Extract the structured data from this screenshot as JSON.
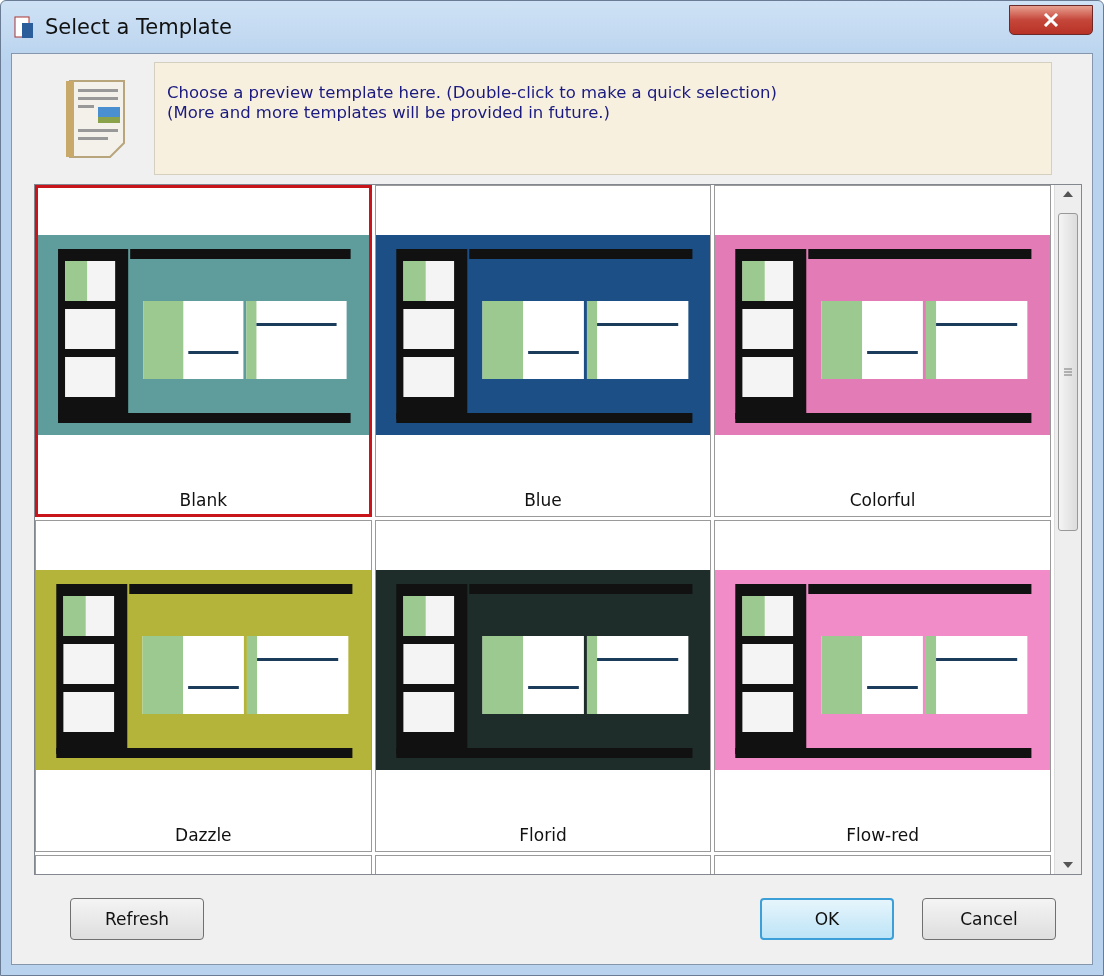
{
  "window": {
    "title": "Select a Template"
  },
  "banner": {
    "lines": [
      "Choose a preview template here. (Double-click to make a quick selection)",
      "(More and more templates will be provided in future.)"
    ]
  },
  "templates": [
    {
      "name": "Blank",
      "selected": true,
      "color": "#5f9c9c"
    },
    {
      "name": "Blue",
      "selected": false,
      "color": "#1b4f86"
    },
    {
      "name": "Colorful",
      "selected": false,
      "color": "#e27bb6"
    },
    {
      "name": "Dazzle",
      "selected": false,
      "color": "#b4b43a"
    },
    {
      "name": "Florid",
      "selected": false,
      "color": "#1e2c2a"
    },
    {
      "name": "Flow-red",
      "selected": false,
      "color": "#f28cc8"
    }
  ],
  "buttons": [
    {
      "label": "Refresh",
      "default": false
    },
    {
      "label": "OK",
      "default": true
    },
    {
      "label": "Cancel",
      "default": false
    }
  ]
}
